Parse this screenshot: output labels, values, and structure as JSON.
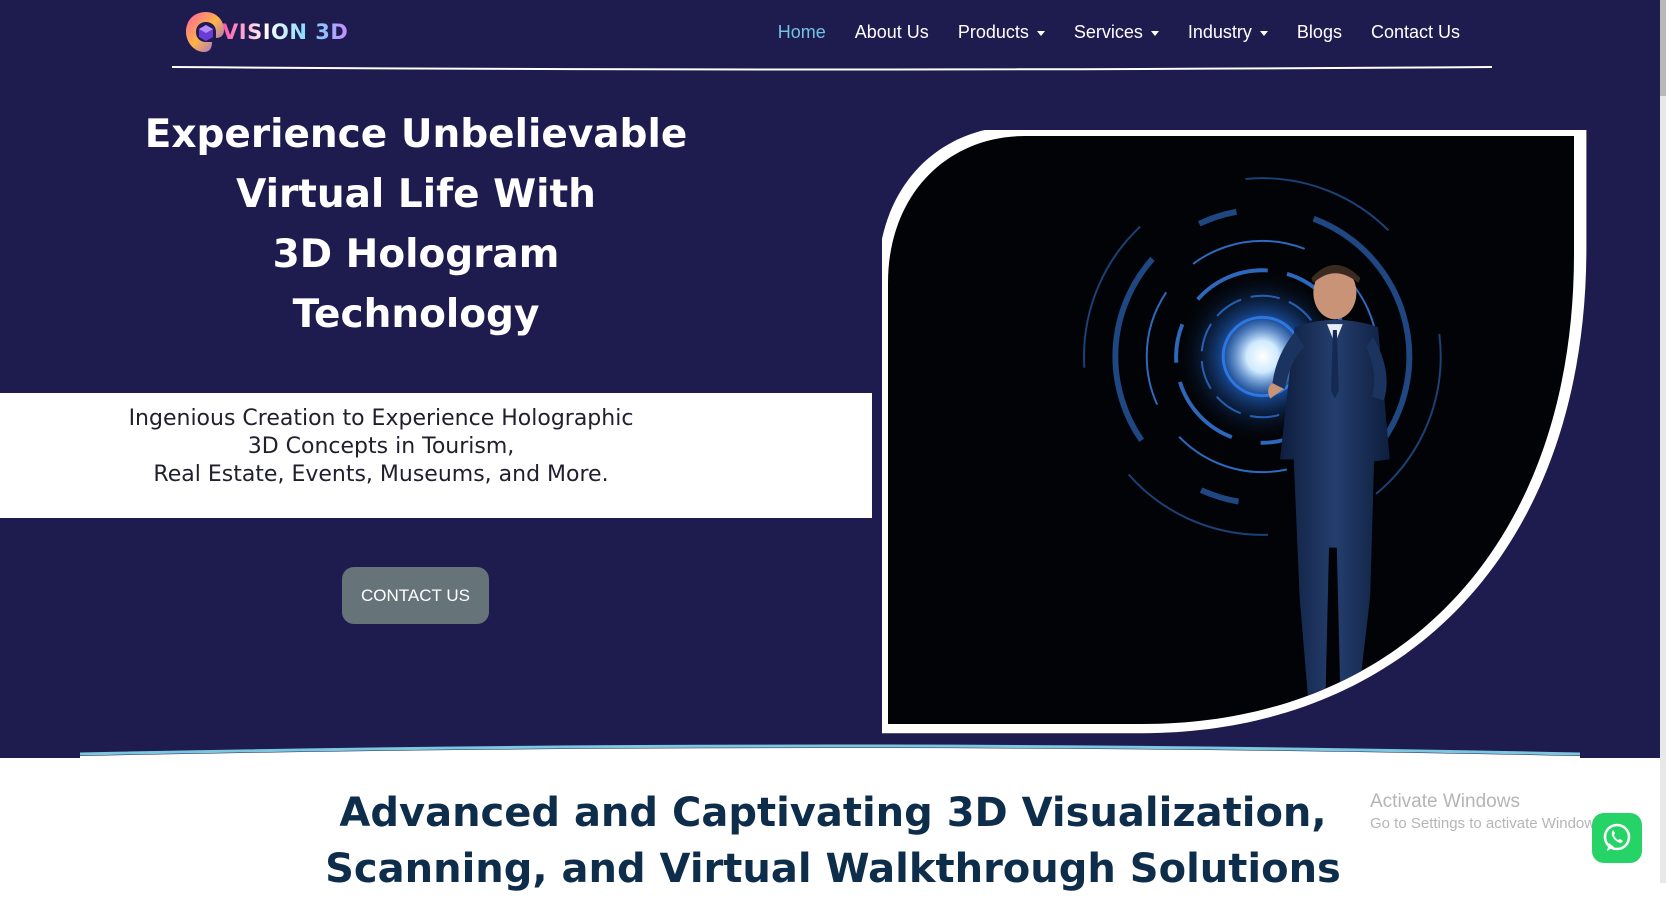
{
  "brand": {
    "logo_text": "VISION 3D",
    "colors": {
      "hero_bg": "#1e1b4f",
      "nav_active": "#74c2e6",
      "cta_bg": "#66747a",
      "section_title": "#0d2d4a",
      "whatsapp": "#25d366"
    }
  },
  "nav": {
    "items": [
      {
        "label": "Home",
        "active": true,
        "dropdown": false
      },
      {
        "label": "About Us",
        "active": false,
        "dropdown": false
      },
      {
        "label": "Products",
        "active": false,
        "dropdown": true
      },
      {
        "label": "Services",
        "active": false,
        "dropdown": true
      },
      {
        "label": "Industry",
        "active": false,
        "dropdown": true
      },
      {
        "label": "Blogs",
        "active": false,
        "dropdown": false
      },
      {
        "label": "Contact Us",
        "active": false,
        "dropdown": false
      }
    ]
  },
  "hero": {
    "headline_lines": [
      "Experience Unbelievable",
      "Virtual Life With",
      "3D Hologram",
      "Technology"
    ],
    "subtext_lines": [
      "Ingenious Creation to Experience Holographic",
      "3D Concepts in Tourism,",
      "Real Estate, Events, Museums, and More."
    ],
    "cta_label": "CONTACT US",
    "image_icon": "hologram-businessman-image"
  },
  "section": {
    "title_lines": [
      "Advanced and Captivating 3D Visualization,",
      "Scanning, and Virtual Walkthrough Solutions"
    ]
  },
  "overlay": {
    "activate_title": "Activate Windows",
    "activate_sub": "Go to Settings to activate Windows.",
    "whatsapp_icon": "whatsapp-icon"
  }
}
